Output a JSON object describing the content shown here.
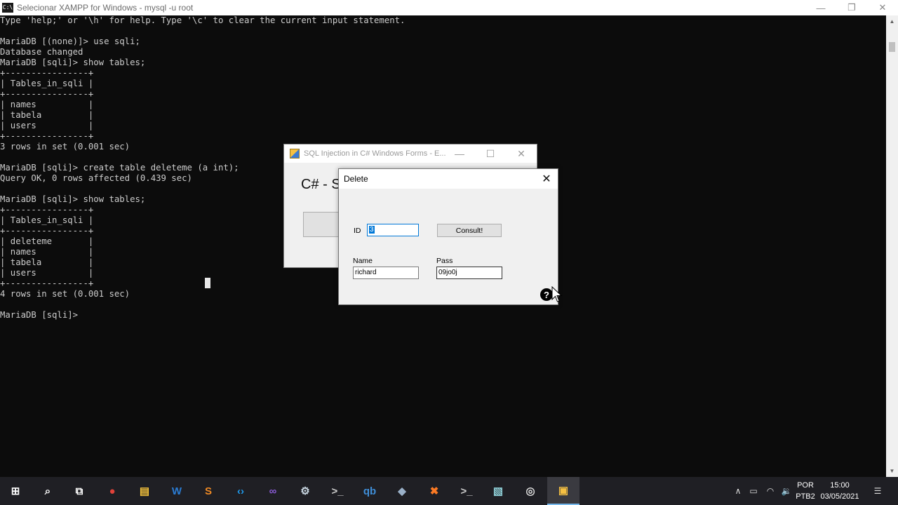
{
  "console": {
    "title": "Selecionar XAMPP for Windows - mysql  -u root",
    "lines": [
      "Type 'help;' or '\\h' for help. Type '\\c' to clear the current input statement.",
      "",
      "MariaDB [(none)]> use sqli;",
      "Database changed",
      "MariaDB [sqli]> show tables;",
      "+----------------+",
      "| Tables_in_sqli |",
      "+----------------+",
      "| names          |",
      "| tabela         |",
      "| users          |",
      "+----------------+",
      "3 rows in set (0.001 sec)",
      "",
      "MariaDB [sqli]> create table deleteme (a int);",
      "Query OK, 0 rows affected (0.439 sec)",
      "",
      "MariaDB [sqli]> show tables;",
      "+----------------+",
      "| Tables_in_sqli |",
      "+----------------+",
      "| deleteme       |",
      "| names          |",
      "| tabela         |",
      "| users          |",
      "+----------------+",
      "4 rows in set (0.001 sec)",
      "",
      "MariaDB [sqli]>"
    ]
  },
  "form_window": {
    "title": "SQL Injection in C# Windows Forms - E...",
    "heading": "C# - S"
  },
  "dialog": {
    "title": "Delete",
    "id_label": "ID",
    "id_value": "3",
    "consult_label": "Consult!",
    "name_label": "Name",
    "name_value": "richard",
    "pass_label": "Pass",
    "pass_value": "09jo0j",
    "help_glyph": "?"
  },
  "taskbar": {
    "apps": [
      {
        "icon": "start-windows-icon",
        "color": "#ffffff"
      },
      {
        "icon": "search-icon",
        "color": "#ffffff"
      },
      {
        "icon": "task-view-icon",
        "color": "#ffffff"
      },
      {
        "icon": "chrome-icon",
        "color": "#e0423a"
      },
      {
        "icon": "file-explorer-icon",
        "color": "#f3c13a"
      },
      {
        "icon": "word-icon",
        "color": "#2b7cd3"
      },
      {
        "icon": "sublime-text-icon",
        "color": "#f08a24"
      },
      {
        "icon": "vscode-icon",
        "color": "#1f9cf0"
      },
      {
        "icon": "visual-studio-icon",
        "color": "#8a5bd6"
      },
      {
        "icon": "steam-icon",
        "color": "#c7d5e0"
      },
      {
        "icon": "terminal-icon",
        "color": "#cccccc"
      },
      {
        "icon": "qbittorrent-icon",
        "color": "#3f8ed8"
      },
      {
        "icon": "app-icon",
        "color": "#9ab0c8"
      },
      {
        "icon": "xampp-icon",
        "color": "#fb7a24"
      },
      {
        "icon": "console-icon",
        "color": "#cccccc"
      },
      {
        "icon": "notepad-icon",
        "color": "#8fd0d8"
      },
      {
        "icon": "obs-icon",
        "color": "#dddddd"
      },
      {
        "icon": "winforms-app-icon",
        "color": "#f5c042"
      }
    ],
    "lang_line1": "POR",
    "lang_line2": "PTB2",
    "time": "15:00",
    "date": "03/05/2021"
  }
}
